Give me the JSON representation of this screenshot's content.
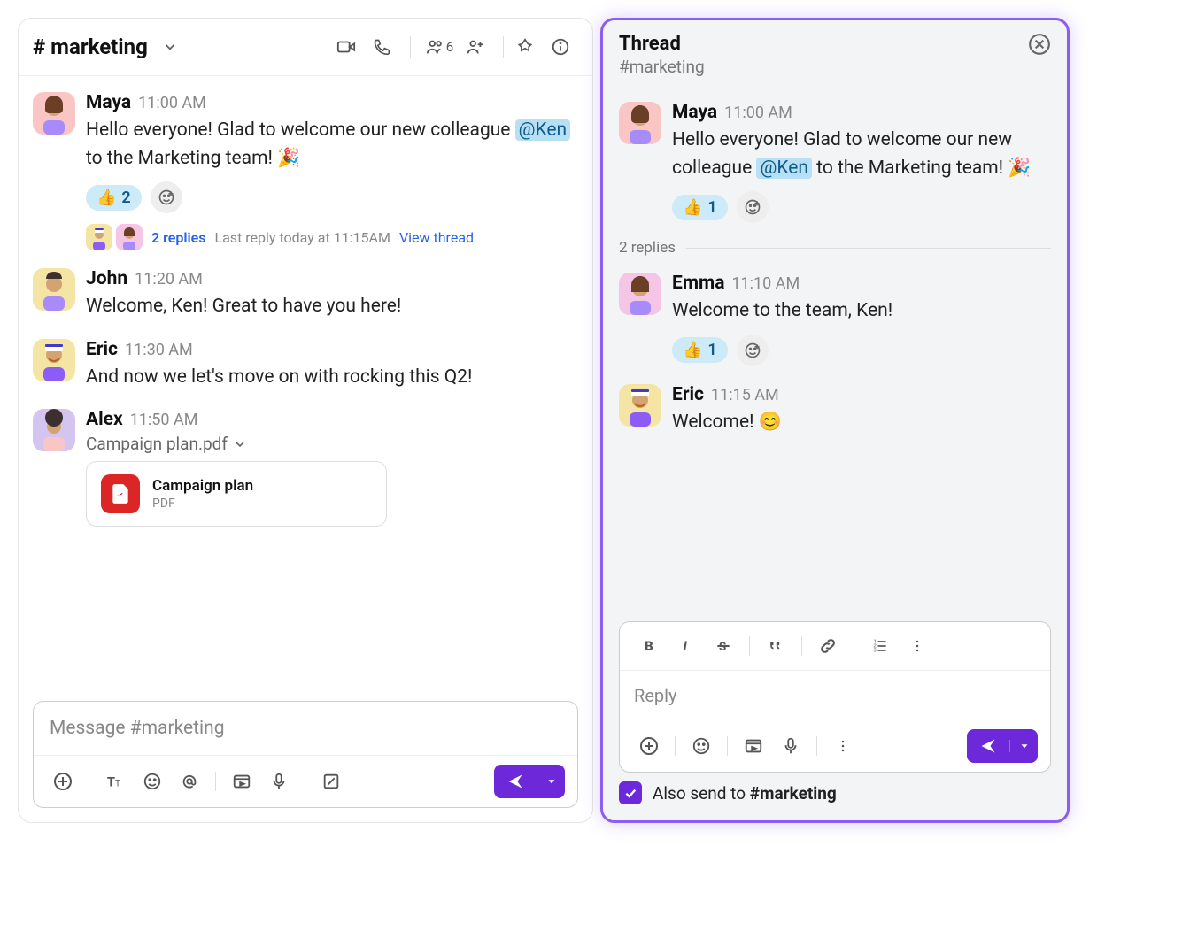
{
  "channel": {
    "name": "# marketing",
    "member_count": "6"
  },
  "messages": [
    {
      "author": "Maya",
      "time": "11:00 AM",
      "text_parts": [
        "Hello everyone! Glad to welcome our new colleague ",
        "@Ken",
        " to the Marketing team! 🎉"
      ],
      "reaction_emoji": "👍",
      "reaction_count": "2",
      "replies_count": "2 replies",
      "last_reply": "Last reply today at 11:15AM",
      "view_thread": "View thread",
      "avatar_bg": "#f9c5c5"
    },
    {
      "author": "John",
      "time": "11:20 AM",
      "text": "Welcome, Ken! Great to have you here!",
      "avatar_bg": "#f5e5a5"
    },
    {
      "author": "Eric",
      "time": "11:30 AM",
      "text": "And now we let's move on with rocking this Q2!",
      "avatar_bg": "#f5e5a5"
    },
    {
      "author": "Alex",
      "time": "11:50 AM",
      "file_label": "Campaign plan.pdf",
      "file_title": "Campaign plan",
      "file_type": "PDF",
      "avatar_bg": "#d4c5f0"
    }
  ],
  "composer": {
    "placeholder": "Message #marketing"
  },
  "thread": {
    "title": "Thread",
    "subtitle": "#marketing",
    "root": {
      "author": "Maya",
      "time": "11:00 AM",
      "text_parts": [
        "Hello everyone! Glad to welcome our new colleague ",
        "@Ken",
        " to the Marketing team! 🎉"
      ],
      "reaction_emoji": "👍",
      "reaction_count": "1",
      "avatar_bg": "#f9c5c5"
    },
    "replies_label": "2 replies",
    "replies": [
      {
        "author": "Emma",
        "time": "11:10 AM",
        "text": "Welcome to the team, Ken!",
        "reaction_emoji": "👍",
        "reaction_count": "1",
        "avatar_bg": "#f5c5e5"
      },
      {
        "author": "Eric",
        "time": "11:15 AM",
        "text": "Welcome! 😊",
        "avatar_bg": "#f5e5a5"
      }
    ],
    "reply_placeholder": "Reply",
    "also_send_prefix": "Also send to ",
    "also_send_channel": "#marketing"
  }
}
